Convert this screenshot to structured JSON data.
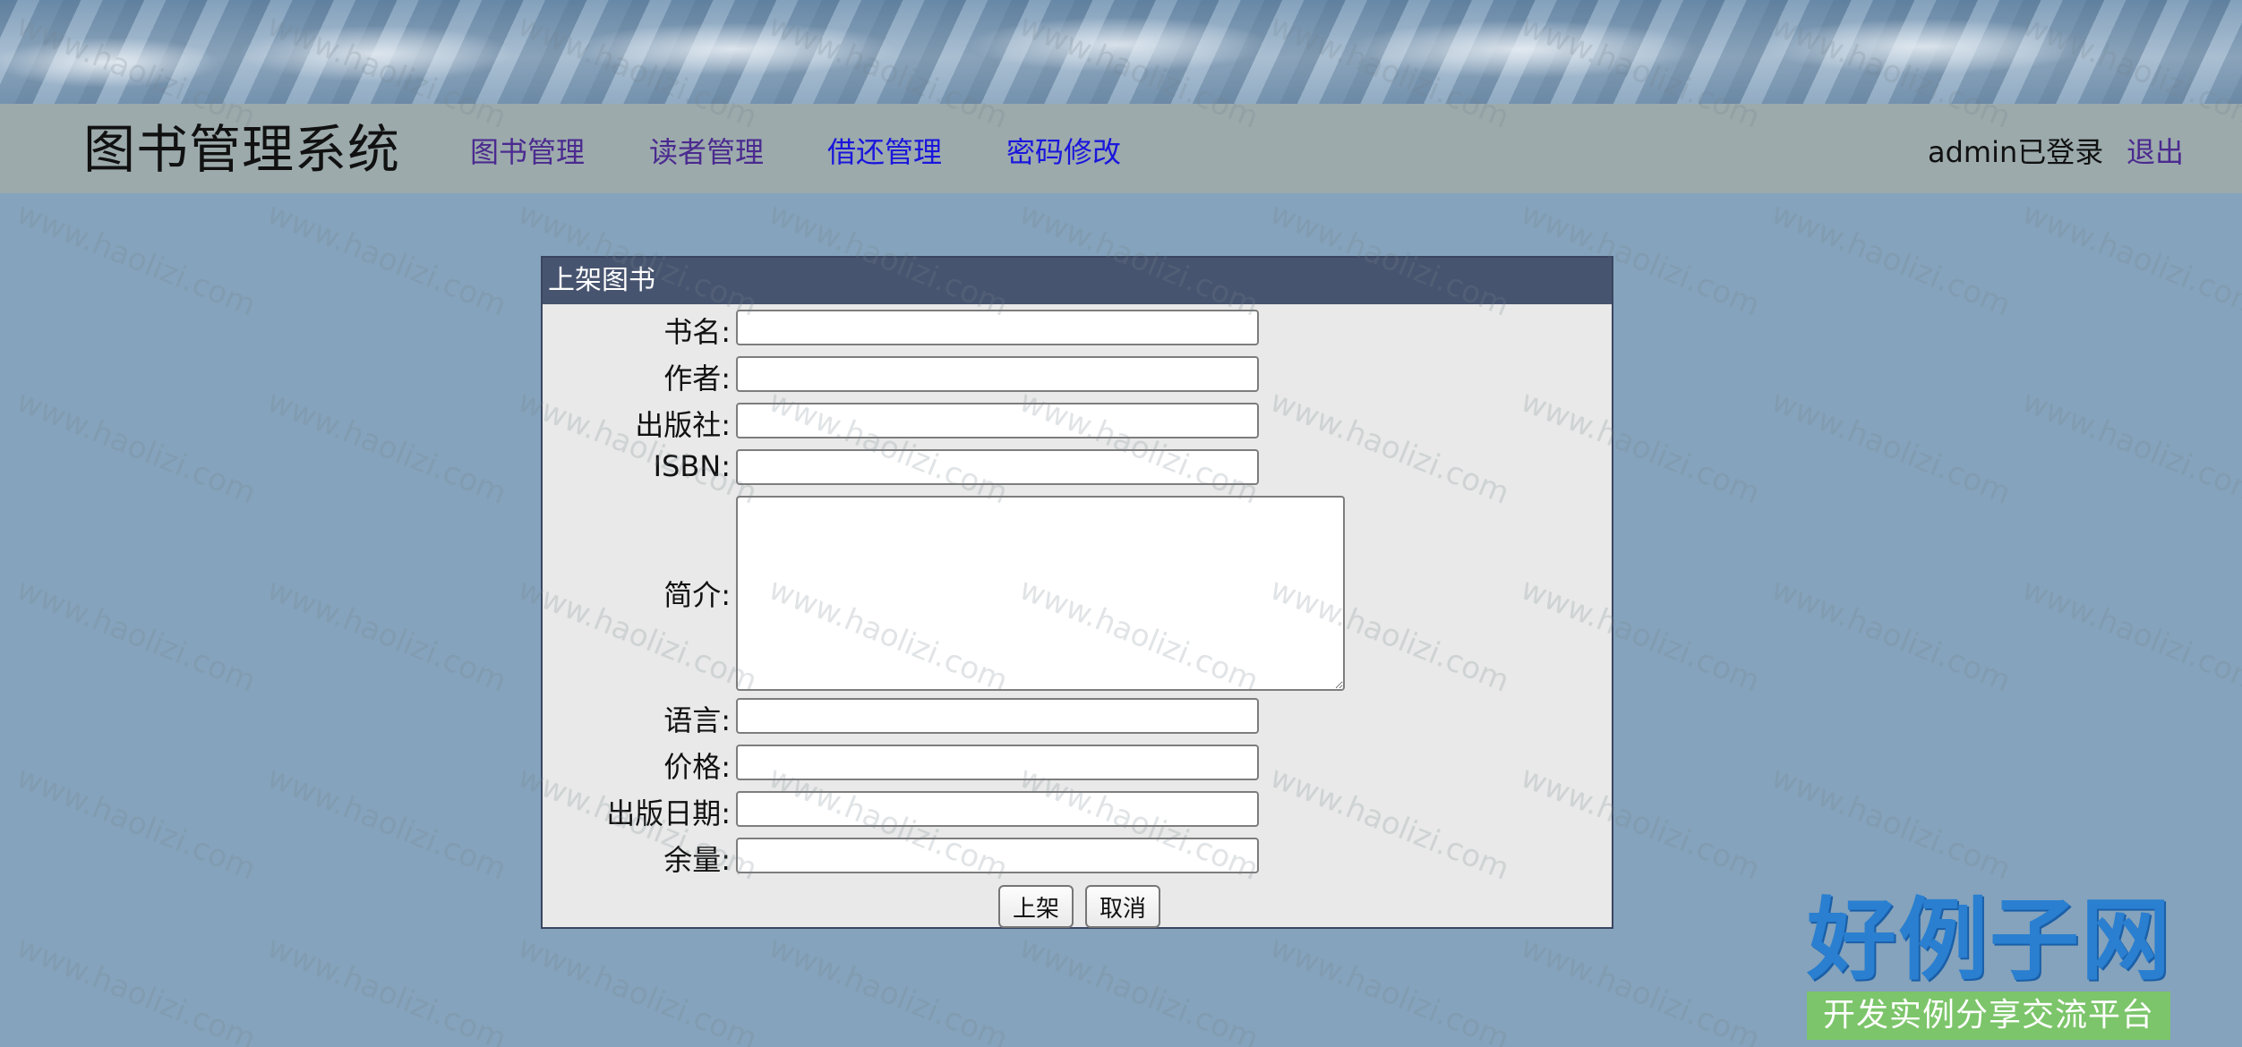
{
  "header": {
    "brand": "图书管理系统",
    "nav": [
      {
        "label": "图书管理"
      },
      {
        "label": "读者管理"
      },
      {
        "label": "借还管理"
      },
      {
        "label": "密码修改"
      }
    ],
    "user_status": "admin已登录",
    "logout_label": "退出"
  },
  "form": {
    "title": "上架图书",
    "fields": [
      {
        "label": "书名:",
        "value": ""
      },
      {
        "label": "作者:",
        "value": ""
      },
      {
        "label": "出版社:",
        "value": ""
      },
      {
        "label": "ISBN:",
        "value": ""
      },
      {
        "label": "简介:",
        "value": ""
      },
      {
        "label": "语言:",
        "value": ""
      },
      {
        "label": "价格:",
        "value": ""
      },
      {
        "label": "出版日期:",
        "value": ""
      },
      {
        "label": "余量:",
        "value": ""
      }
    ],
    "submit_label": "上架",
    "cancel_label": "取消"
  },
  "watermark": {
    "text": "www.haolizi.com"
  },
  "logo": {
    "title": "好例子网",
    "tagline": "开发实例分享交流平台"
  },
  "colors": {
    "page_background": "#85a3bc",
    "navbar": "#9caaac",
    "panel_header": "#47546f",
    "panel_body": "#e8e9e8",
    "nav_link_visited": "#4b2a8f",
    "nav_link": "#1a16dc",
    "logo_blue": "#2a7fd0",
    "logo_green": "#7cc56a"
  }
}
